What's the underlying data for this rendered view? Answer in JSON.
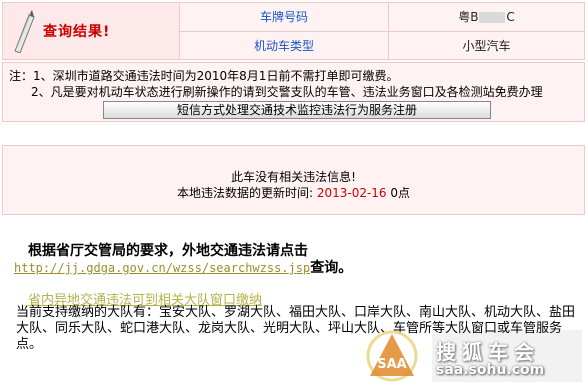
{
  "header": {
    "title": "查询结果!",
    "plate_label": "车牌号码",
    "plate_prefix": "粤B",
    "plate_suffix": "C",
    "type_label": "机动车类型",
    "type_value": "小型汽车"
  },
  "notes": {
    "line1": "注：1、深圳市道路交通违法时间为2010年8月1日前不需打单即可缴费。",
    "line2": "2、凡是要对机动车状态进行刷新操作的请到交警支队的车管、违法业务窗口及各检测站免费办理",
    "sms_button": "短信方式处理交通技术监控违法行为服务注册"
  },
  "result": {
    "no_violation": "此车没有相关违法信息!",
    "update_prefix": "本地违法数据的更新时间:",
    "update_date": "2013-02-16",
    "update_suffix": "0点"
  },
  "section": {
    "heading": "根据省厅交管局的要求，外地交通违法请点击",
    "link_url": "http://jj.gdga.gov.cn/wzss/searchwzss.jsp",
    "link_suffix": "查询。",
    "provincial_link": "省内异地交通违法可到相关大队窗口缴纳",
    "body": "当前支持缴纳的大队有：宝安大队、罗湖大队、福田大队、口岸大队、南山大队、机动大队、盐田大队、同乐大队、蛇口港大队、龙岗大队、光明大队、坪山大队、车管所等大队窗口或车管服务点。"
  },
  "watermark": {
    "badge": "SAA",
    "text": "搜狐车会",
    "url": "saa.sohu.com"
  },
  "colors": {
    "accent": "#cc0000",
    "link": "#1a56c6",
    "panel": "#fff2f2"
  }
}
